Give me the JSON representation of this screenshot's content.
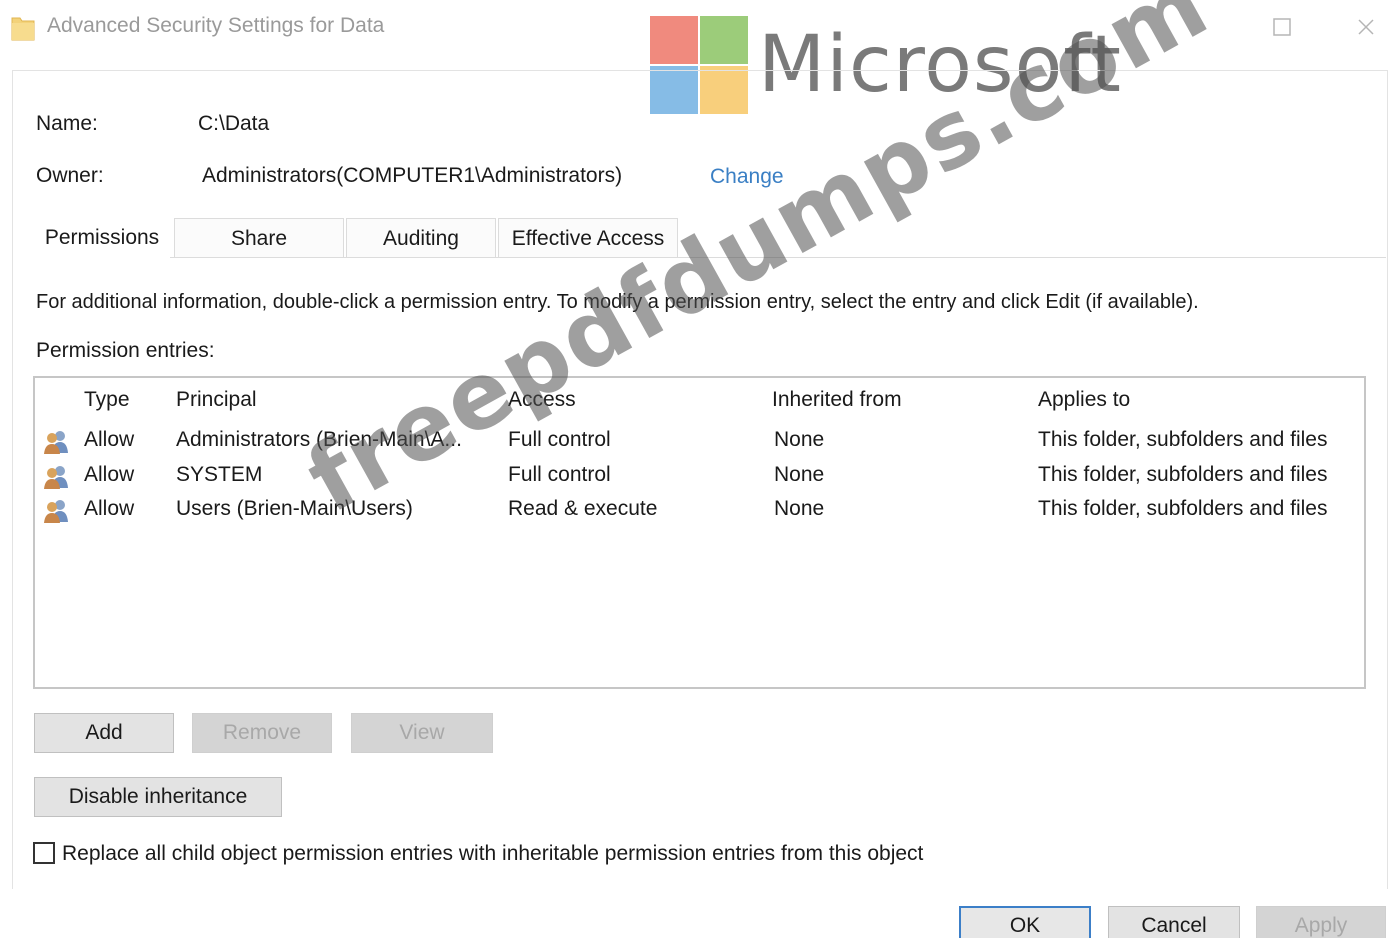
{
  "window": {
    "title": "Advanced Security Settings for Data"
  },
  "details": {
    "name_label": "Name:",
    "name_value": "C:\\Data",
    "owner_label": "Owner:",
    "owner_value": "Administrators(COMPUTER1\\Administrators)",
    "change_link": "Change"
  },
  "tabs": [
    {
      "label": "Permissions",
      "active": true
    },
    {
      "label": "Share",
      "active": false
    },
    {
      "label": "Auditing",
      "active": false
    },
    {
      "label": "Effective Access",
      "active": false
    }
  ],
  "info_text": "For additional information, double-click a permission entry. To modify a permission entry, select the entry and click Edit (if available).",
  "entries_label": "Permission entries:",
  "table": {
    "columns": [
      "Type",
      "Principal",
      "Access",
      "Inherited from",
      "Applies to"
    ],
    "rows": [
      {
        "type": "Allow",
        "principal": "Administrators (Brien-Main\\A...",
        "access": "Full control",
        "inherited": "None",
        "applies": "This folder, subfolders and files",
        "icon": "users-icon"
      },
      {
        "type": "Allow",
        "principal": "SYSTEM",
        "access": "Full control",
        "inherited": "None",
        "applies": "This folder, subfolders and files",
        "icon": "users-icon"
      },
      {
        "type": "Allow",
        "principal": "Users (Brien-Main\\Users)",
        "access": "Read & execute",
        "inherited": "None",
        "applies": "This folder, subfolders and files",
        "icon": "users-icon"
      }
    ]
  },
  "buttons": {
    "add": "Add",
    "remove": "Remove",
    "view": "View",
    "disable_inheritance": "Disable inheritance",
    "ok": "OK",
    "cancel": "Cancel",
    "apply": "Apply"
  },
  "checkbox": {
    "label": "Replace all child object permission entries with inheritable permission entries from this object",
    "checked": false
  },
  "overlay": {
    "logo_text": "Microsoft",
    "watermark": "freepdfdumps.com"
  },
  "colors": {
    "link": "#3a7fc4",
    "default_button_border": "#3c7fc8",
    "logo_red": "#f08a7e",
    "logo_green": "#9ccc7a",
    "logo_blue": "#86bce6",
    "logo_yellow": "#f8cf7c"
  }
}
